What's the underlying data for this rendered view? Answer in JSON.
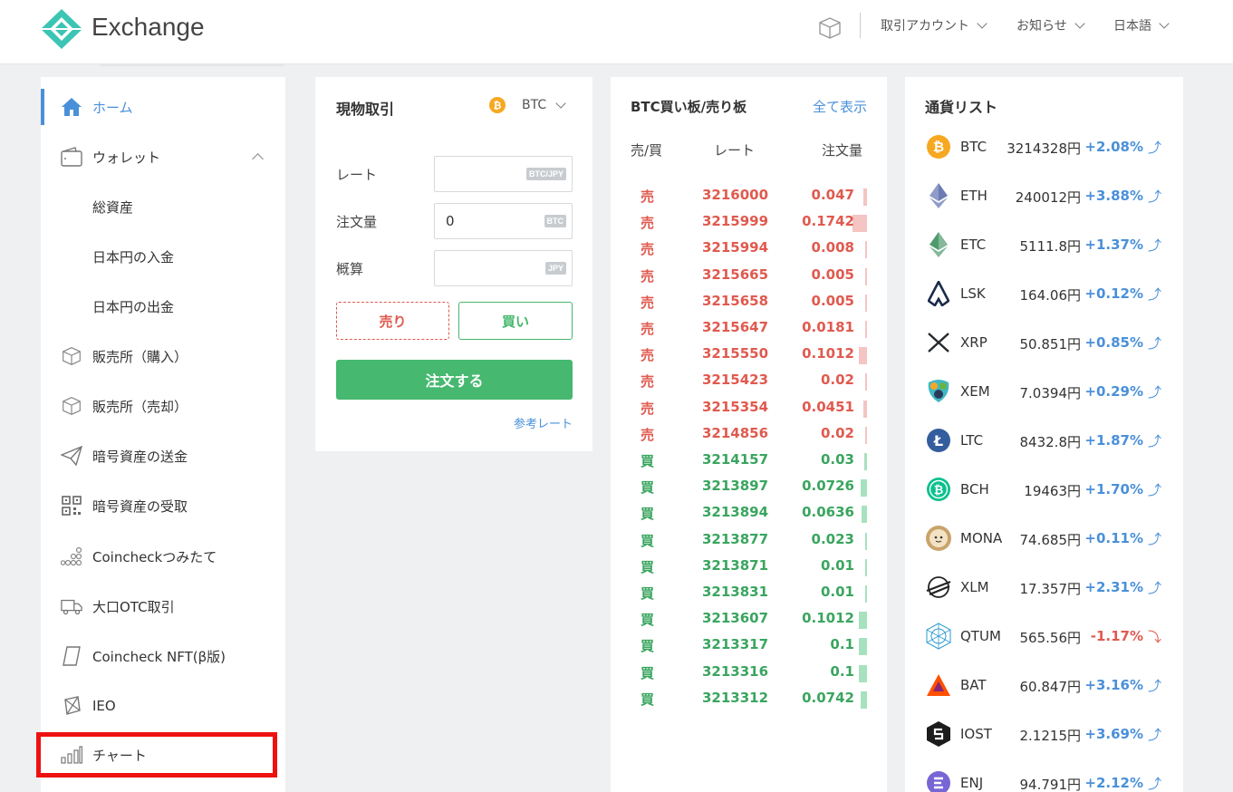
{
  "header": {
    "brand": "Exchange",
    "menu": [
      {
        "label": "取引アカウント"
      },
      {
        "label": "お知らせ"
      },
      {
        "label": "日本語"
      }
    ]
  },
  "sidebar": {
    "items": [
      {
        "label": "ホーム",
        "icon": "home-icon"
      },
      {
        "label": "ウォレット",
        "icon": "wallet-icon"
      },
      {
        "label": "総資産"
      },
      {
        "label": "日本円の入金"
      },
      {
        "label": "日本円の出金"
      },
      {
        "label": "販売所（購入）",
        "icon": "cube-icon"
      },
      {
        "label": "販売所（売却）",
        "icon": "cube-icon"
      },
      {
        "label": "暗号資産の送金",
        "icon": "send-icon"
      },
      {
        "label": "暗号資産の受取",
        "icon": "qr-code-icon"
      },
      {
        "label": "Coincheckつみたて",
        "icon": "coins-stack-icon"
      },
      {
        "label": "大口OTC取引",
        "icon": "truck-icon"
      },
      {
        "label": "Coincheck NFT(β版)",
        "icon": "nft-card-icon"
      },
      {
        "label": "IEO",
        "icon": "ieo-icon"
      },
      {
        "label": "チャート",
        "icon": "bar-chart-icon"
      }
    ]
  },
  "trade": {
    "title": "現物取引",
    "coin": "BTC",
    "rate_label": "レート",
    "rate_tag": "BTC/JPY",
    "qty_label": "注文量",
    "qty_value": "0",
    "qty_tag": "BTC",
    "est_label": "概算",
    "est_tag": "JPY",
    "sell_label": "売り",
    "buy_label": "買い",
    "order_label": "注文する",
    "ref_link": "参考レート"
  },
  "book": {
    "title": "BTC買い板/売り板",
    "show_all": "全て表示",
    "col_side": "売/買",
    "col_rate": "レート",
    "col_qty": "注文量",
    "rows": [
      {
        "side": "売",
        "rate": "3216000",
        "qty": "0.047"
      },
      {
        "side": "売",
        "rate": "3215999",
        "qty": "0.1742"
      },
      {
        "side": "売",
        "rate": "3215994",
        "qty": "0.008"
      },
      {
        "side": "売",
        "rate": "3215665",
        "qty": "0.005"
      },
      {
        "side": "売",
        "rate": "3215658",
        "qty": "0.005"
      },
      {
        "side": "売",
        "rate": "3215647",
        "qty": "0.0181"
      },
      {
        "side": "売",
        "rate": "3215550",
        "qty": "0.1012"
      },
      {
        "side": "売",
        "rate": "3215423",
        "qty": "0.02"
      },
      {
        "side": "売",
        "rate": "3215354",
        "qty": "0.0451"
      },
      {
        "side": "売",
        "rate": "3214856",
        "qty": "0.02"
      },
      {
        "side": "買",
        "rate": "3214157",
        "qty": "0.03"
      },
      {
        "side": "買",
        "rate": "3213897",
        "qty": "0.0726"
      },
      {
        "side": "買",
        "rate": "3213894",
        "qty": "0.0636"
      },
      {
        "side": "買",
        "rate": "3213877",
        "qty": "0.023"
      },
      {
        "side": "買",
        "rate": "3213871",
        "qty": "0.01"
      },
      {
        "side": "買",
        "rate": "3213831",
        "qty": "0.01"
      },
      {
        "side": "買",
        "rate": "3213607",
        "qty": "0.1012"
      },
      {
        "side": "買",
        "rate": "3213317",
        "qty": "0.1"
      },
      {
        "side": "買",
        "rate": "3213316",
        "qty": "0.1"
      },
      {
        "side": "買",
        "rate": "3213312",
        "qty": "0.0742"
      }
    ]
  },
  "currencies": {
    "title": "通貨リスト",
    "rows": [
      {
        "sym": "BTC",
        "price": "3214328円",
        "chg": "+2.08%",
        "dir": "up",
        "color": "#f7a821"
      },
      {
        "sym": "ETH",
        "price": "240012円",
        "chg": "+3.88%",
        "dir": "up",
        "color": "#6b7bb5"
      },
      {
        "sym": "ETC",
        "price": "5111.8円",
        "chg": "+1.37%",
        "dir": "up",
        "color": "#4f9a6d"
      },
      {
        "sym": "LSK",
        "price": "164.06円",
        "chg": "+0.12%",
        "dir": "up",
        "color": "#1a2a4a"
      },
      {
        "sym": "XRP",
        "price": "50.851円",
        "chg": "+0.85%",
        "dir": "up",
        "color": "#23292f"
      },
      {
        "sym": "XEM",
        "price": "7.0394円",
        "chg": "+0.29%",
        "dir": "up",
        "color": "#41b8c4"
      },
      {
        "sym": "LTC",
        "price": "8432.8円",
        "chg": "+1.87%",
        "dir": "up",
        "color": "#345d9d"
      },
      {
        "sym": "BCH",
        "price": "19463円",
        "chg": "+1.70%",
        "dir": "up",
        "color": "#0ac18e"
      },
      {
        "sym": "MONA",
        "price": "74.685円",
        "chg": "+0.11%",
        "dir": "up",
        "color": "#c9a36b"
      },
      {
        "sym": "XLM",
        "price": "17.357円",
        "chg": "+2.31%",
        "dir": "up",
        "color": "#222222"
      },
      {
        "sym": "QTUM",
        "price": "565.56円",
        "chg": "-1.17%",
        "dir": "down",
        "color": "#2e9ad0"
      },
      {
        "sym": "BAT",
        "price": "60.847円",
        "chg": "+3.16%",
        "dir": "up",
        "color": "#ff5000"
      },
      {
        "sym": "IOST",
        "price": "2.1215円",
        "chg": "+3.69%",
        "dir": "up",
        "color": "#1c1c1c"
      },
      {
        "sym": "ENJ",
        "price": "94.791円",
        "chg": "+2.12%",
        "dir": "up",
        "color": "#7866d5"
      }
    ]
  },
  "colors": {
    "accent": "#4a90d9",
    "sell": "#e05a4f",
    "buy": "#3aa55f",
    "order_button": "#46b870",
    "highlight": "#ee1111"
  }
}
